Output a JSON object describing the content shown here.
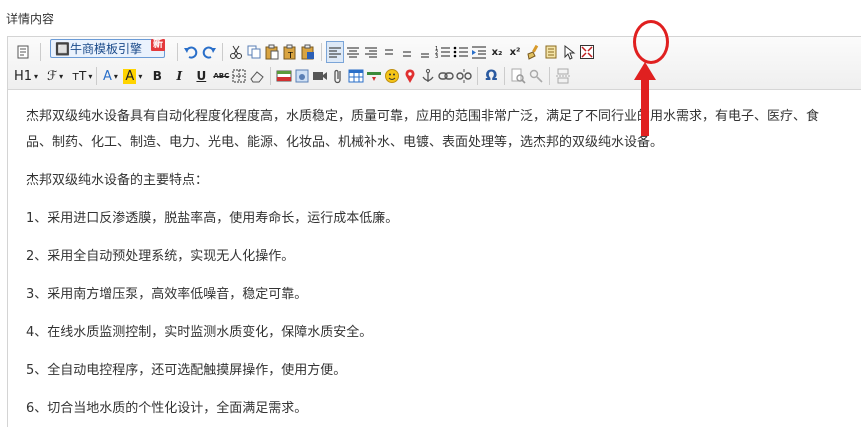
{
  "page": {
    "label": "详情内容"
  },
  "toolbar": {
    "template_label": "🔲牛商模板引擎",
    "template_badge": "新",
    "heading_label": "H1",
    "font_label": "ℱ",
    "size_label": "тT",
    "font_color_label": "A",
    "bg_color_label": "A",
    "bold": "B",
    "italic": "I",
    "underline": "U",
    "strike": "ABC",
    "sub": "x₂",
    "sup": "x²",
    "omega": "Ω"
  },
  "content": {
    "paragraphs": [
      "杰邦双级纯水设备具有自动化程度化程度高，水质稳定，质量可靠，应用的范围非常广泛，满足了不同行业的用水需求，有电子、医疗、食",
      "品、制药、化工、制造、电力、光电、能源、化妆品、机械补水、电镀、表面处理等，选杰邦的双级纯水设备。",
      "杰邦双级纯水设备的主要特点：",
      "1、采用进口反渗透膜，脱盐率高，使用寿命长，运行成本低廉。",
      "2、采用全自动预处理系统，实现无人化操作。",
      "3、采用南方增压泵，高效率低噪音，稳定可靠。",
      "4、在线水质监测控制，实时监测水质变化，保障水质安全。",
      "5、全自动电控程序，还可选配触摸屏操作，使用方便。",
      "6、切合当地水质的个性化设计，全面满足需求。"
    ]
  },
  "colors": {
    "annotation": "#e02020",
    "accent": "#1a4a8a"
  }
}
